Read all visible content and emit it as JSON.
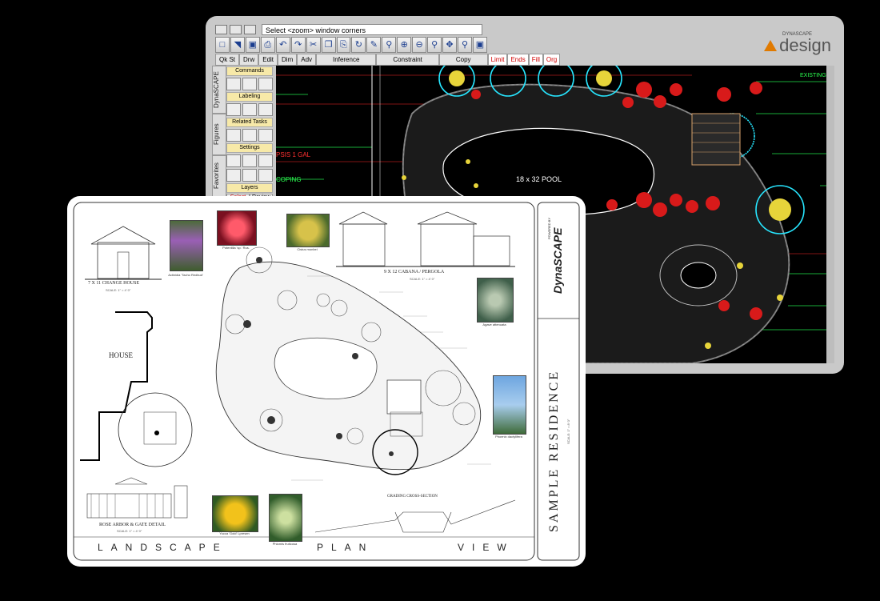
{
  "window": {
    "command_line": "Select <zoom> window corners",
    "menu": [
      "Qk St",
      "Drw",
      "Edit",
      "Dim",
      "Adv",
      "Inference",
      "Constraint",
      "Copy"
    ],
    "menu_red": [
      "Limit",
      "Ends",
      "Fill",
      "Org"
    ],
    "brand_small": "DYNASCAPE",
    "brand_word": "design",
    "side_tabs": [
      "DynaSCAPE",
      "Figures",
      "Favorites"
    ],
    "panel_sections": [
      "Commands",
      "Labeling",
      "Related Tasks",
      "Settings",
      "Layers"
    ],
    "panel_tabs": [
      "Select",
      "Review"
    ],
    "canvas_labels": {
      "pool": "18 x 32 POOL",
      "existing": "EXISTING",
      "gal": "PSIS 1 GAL",
      "coping": "COPING"
    },
    "colors": {
      "accent": "#e07a00",
      "cad_bg": "#000000",
      "red_menu": "#d10000"
    }
  },
  "paper": {
    "title_block": {
      "powered_by": "POWERED BY",
      "logo": "DynaSCAPE",
      "project": "SAMPLE RESIDENCE",
      "scale": "SCALE: 1\" = 8' 0\""
    },
    "footer": {
      "landscape": "LANDSCAPE",
      "plan": "PLAN",
      "view": "VIEW"
    },
    "house_label": "HOUSE",
    "details": {
      "change_house": "7 X 11 CHANGE HOUSE",
      "change_scale": "SCALE: 1\" = 4' 0\"",
      "cabana": "9 X 12 CABANA / PERGOLA",
      "cabana_scale": "SCALE: 1\" = 4' 0\"",
      "gate": "ROSE ARBOR & GATE DETAIL",
      "gate_scale": "SCALE: 1\" = 4' 0\"",
      "section": "GRADING CROSS-SECTION"
    },
    "photos": [
      {
        "caption": "Actinidia 'Tacho Redbud'"
      },
      {
        "caption": "Potentilla 'sp.' Rus."
      },
      {
        "caption": "Cistus monbei"
      },
      {
        "caption": "Agave attenuata"
      },
      {
        "caption": "Phoenix dactylifera"
      },
      {
        "caption": "Yucca 'Gold' Lpresen"
      },
      {
        "caption": "Phlomis fruticosa"
      }
    ]
  }
}
